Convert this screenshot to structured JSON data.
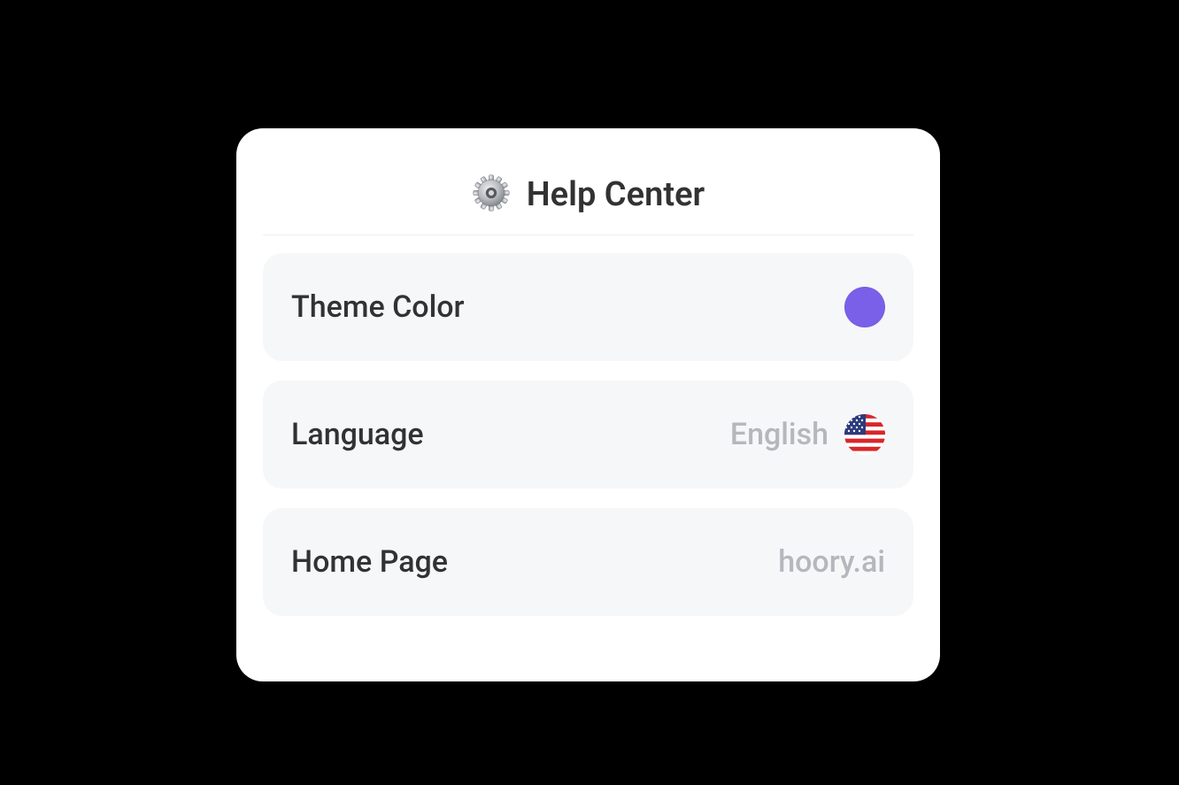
{
  "header": {
    "title": "Help Center",
    "icon_name": "gear-icon"
  },
  "settings": {
    "theme_color": {
      "label": "Theme Color",
      "value_hex": "#7A60E8"
    },
    "language": {
      "label": "Language",
      "value": "English",
      "flag": "us"
    },
    "home_page": {
      "label": "Home Page",
      "value": "hoory.ai"
    }
  }
}
